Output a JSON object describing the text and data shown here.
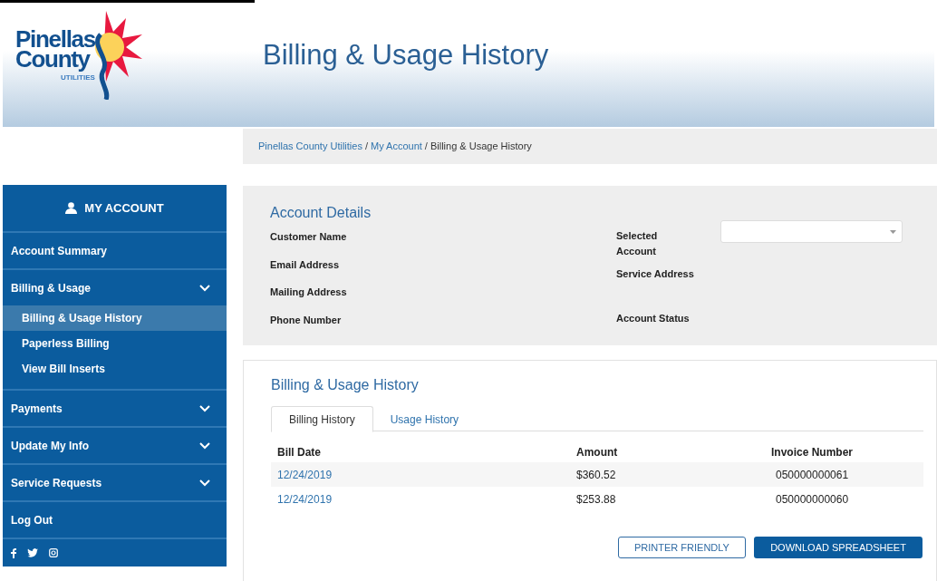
{
  "logo": {
    "line_1": "Pinellas",
    "line_2": "County",
    "line_3": "UTILITIES"
  },
  "page_title": "Billing & Usage History",
  "breadcrumb": {
    "links": [
      "Pinellas County Utilities",
      "My Account"
    ],
    "separator": "/",
    "current": "Billing & Usage History"
  },
  "sidebar": {
    "header": "MY ACCOUNT",
    "items": [
      {
        "label": "Account Summary",
        "expandable": false
      },
      {
        "label": "Billing & Usage",
        "expandable": true,
        "children": [
          {
            "label": "Billing & Usage History",
            "selected": true
          },
          {
            "label": "Paperless Billing",
            "selected": false
          },
          {
            "label": "View Bill Inserts",
            "selected": false
          }
        ]
      },
      {
        "label": "Payments",
        "expandable": true
      },
      {
        "label": "Update My Info",
        "expandable": true
      },
      {
        "label": "Service Requests",
        "expandable": true
      },
      {
        "label": "Log Out",
        "expandable": false
      }
    ]
  },
  "account_details": {
    "title": "Account Details",
    "left_fields": [
      "Customer Name",
      "Email Address",
      "Mailing Address",
      "Phone Number"
    ],
    "selected_account_label": "Selected Account",
    "right_fields": [
      "Service Address",
      "Account Status"
    ]
  },
  "history": {
    "title": "Billing & Usage History",
    "tabs": [
      {
        "label": "Billing History",
        "selected": true
      },
      {
        "label": "Usage History",
        "selected": false
      }
    ],
    "columns": [
      "Bill Date",
      "Amount",
      "Invoice Number"
    ],
    "rows": [
      {
        "bill_date": "12/24/2019",
        "amount": "$360.52",
        "invoice_number": "050000000061"
      },
      {
        "bill_date": "12/24/2019",
        "amount": "$253.88",
        "invoice_number": "050000000060"
      }
    ],
    "buttons": [
      "PRINTER FRIENDLY",
      "DOWNLOAD SPREADSHEET"
    ]
  }
}
